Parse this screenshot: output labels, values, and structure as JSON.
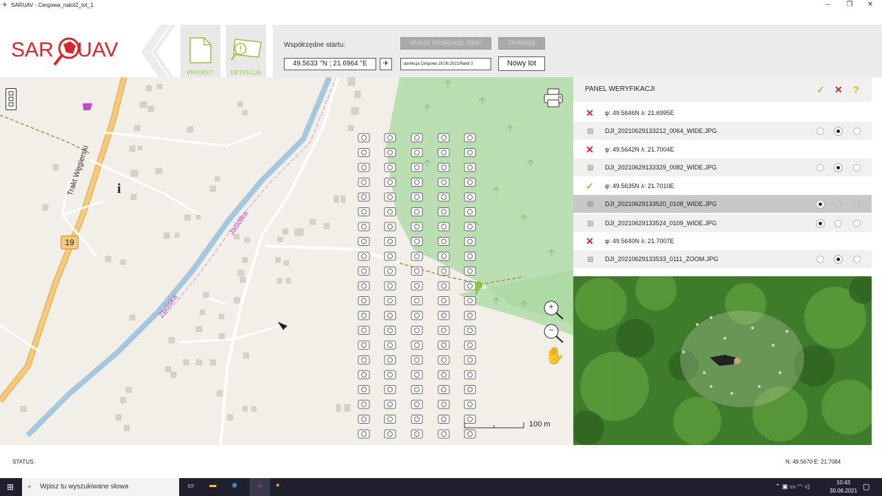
{
  "window": {
    "title": "SARUAV - Cergowa_nalot2_lot_1",
    "minimize": "–",
    "maximize": "❐",
    "close": "✕"
  },
  "logo": {
    "left": "SAR",
    "right": "UAV"
  },
  "nav": {
    "project": "PROJEKT",
    "detection": "DETEKCJA"
  },
  "controls": {
    "start_label": "Współrzędne startu:",
    "start_coords": "49.5633 °N ;  21.6964 °E",
    "locate_photos": "Wskaż lokalizację zdjęć",
    "detect": "Detekcja",
    "path": ":op/Akcja Cergowa 29.06.2021/Nalot 2",
    "new_flight": "Nowy lot"
  },
  "map": {
    "road_label": "Trakt Węgierski",
    "road_number": "19",
    "river_label": "Jasiółka",
    "street_label": "Zboiska",
    "scale": "100 m",
    "zoom_in": "+",
    "zoom_out": "−"
  },
  "panel": {
    "title": "PANEL WERYFIKACJI",
    "header_icons": {
      "confirm": "✓",
      "reject": "✕",
      "unknown": "?"
    },
    "entries": [
      {
        "status": "reject",
        "coord": "φ: 49.5646N λ: 21.6995E",
        "images": [
          {
            "file": "DJI_20210629133212_0064_WIDE.JPG",
            "choice": 1
          }
        ]
      },
      {
        "status": "reject",
        "coord": "φ: 49.5642N λ: 21.7004E",
        "images": [
          {
            "file": "DJI_20210629133329_0082_WIDE.JPG",
            "choice": 1
          }
        ]
      },
      {
        "status": "confirm",
        "coord": "φ: 49.5635N λ: 21.7010E",
        "images": [
          {
            "file": "DJI_20210629133520_0108_WIDE.JPG",
            "choice": 0,
            "selected": true
          },
          {
            "file": "DJI_20210629133524_0109_WIDE.JPG",
            "choice": 0
          }
        ]
      },
      {
        "status": "reject",
        "coord": "φ: 49.5640N λ: 21.7007E",
        "images": [
          {
            "file": "DJI_20210629133533_0111_ZOOM.JPG",
            "choice": 1
          }
        ]
      }
    ],
    "status_colors": {
      "reject": "#e02020",
      "confirm": "#8cc63f",
      "unknown": "#f0a800"
    }
  },
  "status": {
    "label": "STATUS:",
    "coords": "N: 49.5670 E: 21.7084"
  },
  "taskbar": {
    "search_placeholder": "Wpisz tu wyszukiwane słowa",
    "time": "10:43",
    "date": "30.06.2021"
  },
  "colors": {
    "accent": "#8cc63f",
    "brand": "#d9262c"
  }
}
